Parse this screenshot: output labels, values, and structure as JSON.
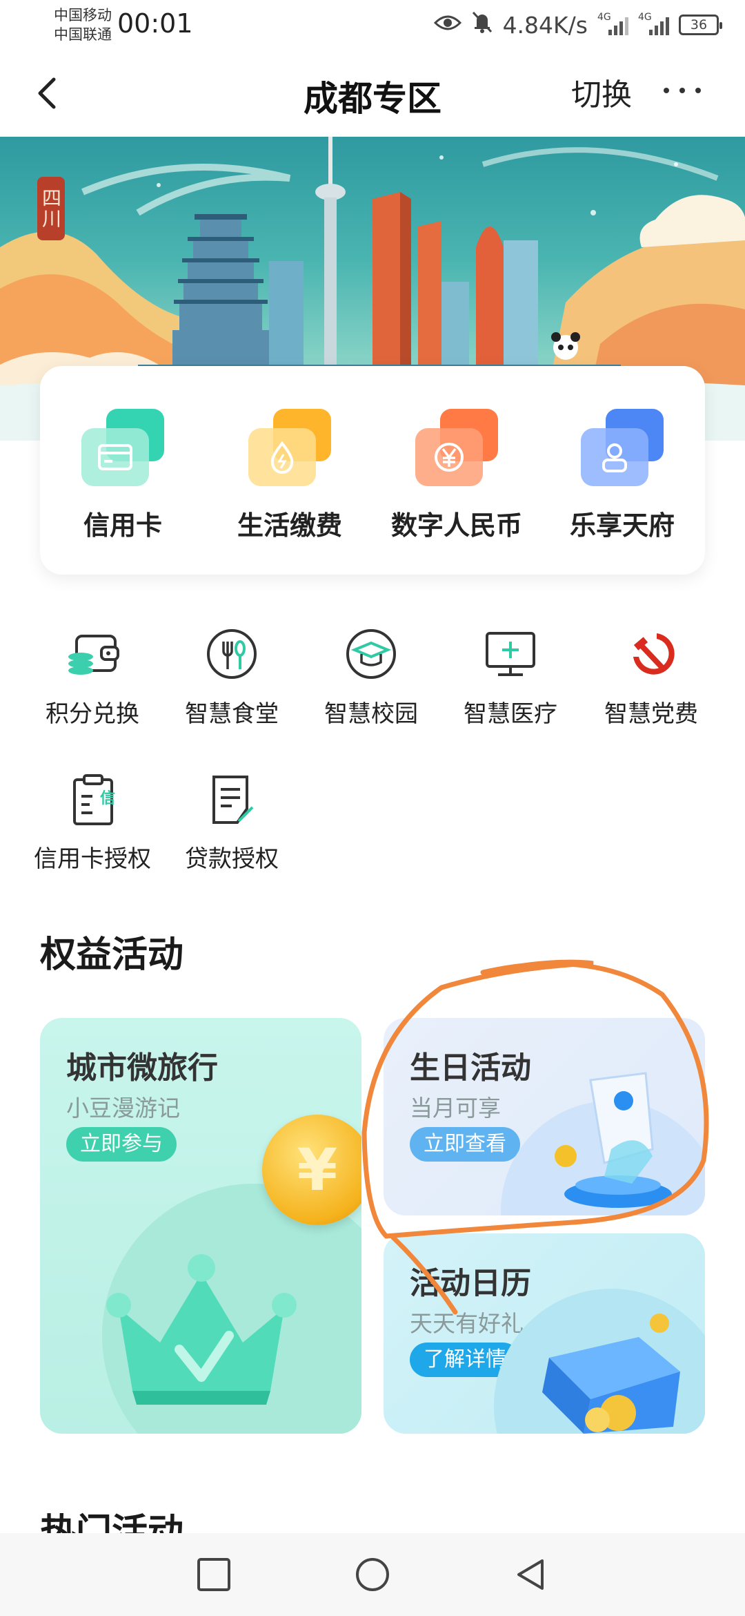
{
  "status_bar": {
    "carrier_1": "中国移动",
    "carrier_2": "中国联通",
    "time": "00:01",
    "speed": "4.84K/s",
    "net_1": "4G",
    "net_2": "4G",
    "battery": "36"
  },
  "header": {
    "title": "成都专区",
    "switch_label": "切换"
  },
  "banner": {
    "seal_text": "四川"
  },
  "quick_actions": [
    {
      "label": "信用卡",
      "icon": "credit-card-icon",
      "color": "#34d3b2"
    },
    {
      "label": "生活缴费",
      "icon": "water-drop-icon",
      "color": "#ffb52b"
    },
    {
      "label": "数字人民币",
      "icon": "yuan-coin-icon",
      "color": "#ff7a45"
    },
    {
      "label": "乐享天府",
      "icon": "person-icon",
      "color": "#4d86f5"
    }
  ],
  "services_row1": [
    {
      "label": "积分兑换",
      "icon": "wallet-coins-icon"
    },
    {
      "label": "智慧食堂",
      "icon": "fork-spoon-icon"
    },
    {
      "label": "智慧校园",
      "icon": "graduation-cap-icon"
    },
    {
      "label": "智慧医疗",
      "icon": "monitor-plus-icon"
    },
    {
      "label": "智慧党费",
      "icon": "hammer-sickle-icon"
    }
  ],
  "services_row2": [
    {
      "label": "信用卡授权",
      "icon": "clipboard-credit-icon",
      "badge": "信"
    },
    {
      "label": "贷款授权",
      "icon": "document-edit-icon"
    }
  ],
  "benefits": {
    "title": "权益活动",
    "cards": [
      {
        "title": "城市微旅行",
        "subtitle": "小豆漫游记",
        "button": "立即参与",
        "coin": "¥"
      },
      {
        "title": "生日活动",
        "subtitle": "当月可享",
        "button": "立即查看"
      },
      {
        "title": "活动日历",
        "subtitle": "天天有好礼",
        "button": "了解详情"
      }
    ]
  },
  "hot": {
    "title": "热门活动"
  },
  "colors": {
    "accent_green": "#2fc9a4",
    "accent_blue": "#2aa9ef",
    "annotation_orange": "#f0873a"
  }
}
